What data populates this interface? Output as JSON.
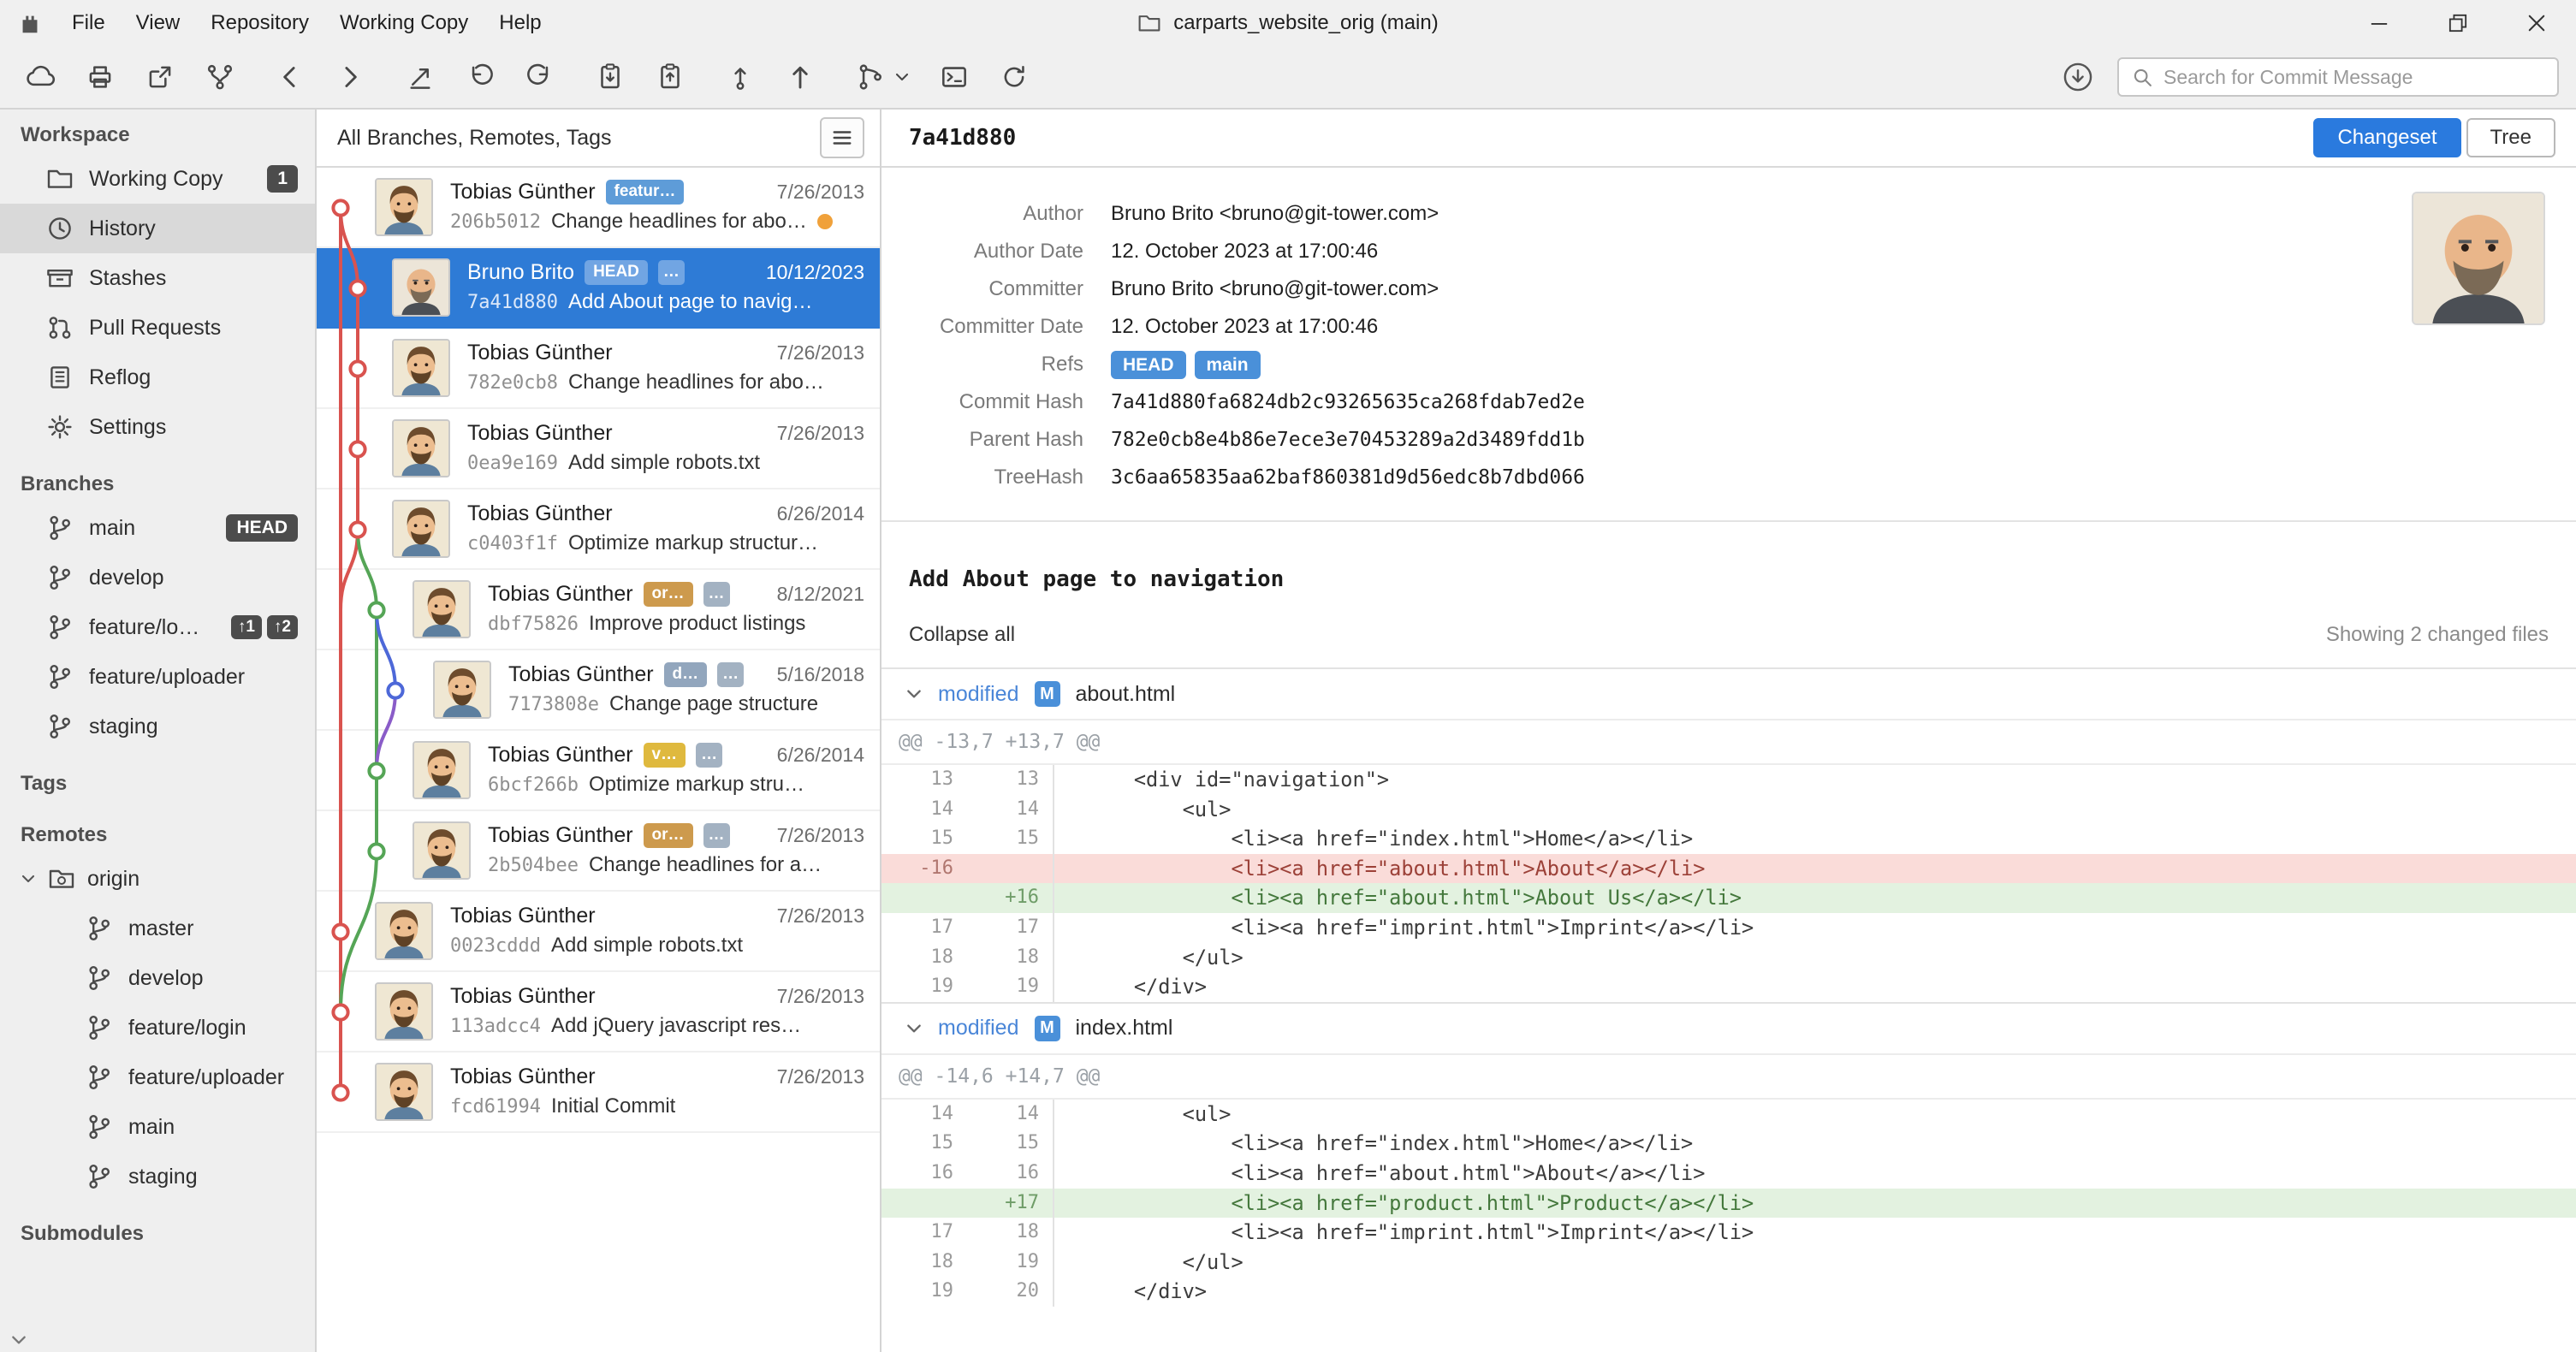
{
  "colors": {
    "selection_blue": "#2e7bd6",
    "accent_blue": "#2a7ade",
    "badge_blue": "#4a90d9",
    "badge_orange": "#cd9a4d",
    "badge_yellow": "#dfb93e",
    "badge_slate": "#92a6bd",
    "badge_dark": "#4c4c4c",
    "graph_red": "#d9534f",
    "graph_green": "#55a556",
    "graph_blue": "#4d68d8",
    "graph_purple": "#8a5cc8",
    "diff_added_bg": "#e3f2e0",
    "diff_removed_bg": "#fadcd9",
    "status_dot_orange": "#f0a13a"
  },
  "titlebar": {
    "menu": [
      "File",
      "View",
      "Repository",
      "Working Copy",
      "Help"
    ],
    "title": "carparts_website_orig (main)"
  },
  "toolbar": {
    "search_placeholder": "Search for Commit Message"
  },
  "sidebar": {
    "headers": {
      "workspace": "Workspace",
      "branches": "Branches",
      "tags": "Tags",
      "remotes": "Remotes",
      "submodules": "Submodules"
    },
    "workspace_items": [
      {
        "label": "Working Copy",
        "badge": "1"
      },
      {
        "label": "History"
      },
      {
        "label": "Stashes"
      },
      {
        "label": "Pull Requests"
      },
      {
        "label": "Reflog"
      },
      {
        "label": "Settings"
      }
    ],
    "branches": [
      {
        "label": "main",
        "badge": "HEAD"
      },
      {
        "label": "develop"
      },
      {
        "label": "feature/lo…",
        "ahead": "↑1",
        "behind": "↑2"
      },
      {
        "label": "feature/uploader"
      },
      {
        "label": "staging"
      }
    ],
    "remotes": {
      "origin": "origin",
      "children": [
        "master",
        "develop",
        "feature/login",
        "feature/uploader",
        "main",
        "staging"
      ]
    }
  },
  "commit_list": {
    "filter_label": "All Branches, Remotes, Tags",
    "commits": [
      {
        "author": "Tobias Günther",
        "badge": "featur…",
        "date": "7/26/2013",
        "hash": "206b5012",
        "message": "Change headlines for abo…"
      },
      {
        "author": "Bruno Brito",
        "badge": "HEAD",
        "badge2": "…",
        "date": "10/12/2023",
        "hash": "7a41d880",
        "message": "Add About page to navig…"
      },
      {
        "author": "Tobias Günther",
        "date": "7/26/2013",
        "hash": "782e0cb8",
        "message": "Change headlines for abo…"
      },
      {
        "author": "Tobias Günther",
        "date": "7/26/2013",
        "hash": "0ea9e169",
        "message": "Add simple robots.txt"
      },
      {
        "author": "Tobias Günther",
        "date": "6/26/2014",
        "hash": "c0403f1f",
        "message": "Optimize markup structur…"
      },
      {
        "author": "Tobias Günther",
        "badge": "or…",
        "badge2": "…",
        "date": "8/12/2021",
        "hash": "dbf75826",
        "message": "Improve product listings"
      },
      {
        "author": "Tobias Günther",
        "badge": "d…",
        "badge2": "…",
        "date": "5/16/2018",
        "hash": "7173808e",
        "message": "Change page structure"
      },
      {
        "author": "Tobias Günther",
        "badge": "v…",
        "badge2": "…",
        "date": "6/26/2014",
        "hash": "6bcf266b",
        "message": "Optimize markup stru…"
      },
      {
        "author": "Tobias Günther",
        "badge": "or…",
        "badge2": "…",
        "date": "7/26/2013",
        "hash": "2b504bee",
        "message": "Change headlines for a…"
      },
      {
        "author": "Tobias Günther",
        "date": "7/26/2013",
        "hash": "0023cddd",
        "message": "Add simple robots.txt"
      },
      {
        "author": "Tobias Günther",
        "date": "7/26/2013",
        "hash": "113adcc4",
        "message": "Add jQuery javascript res…"
      },
      {
        "author": "Tobias Günther",
        "date": "7/26/2013",
        "hash": "fcd61994",
        "message": "Initial Commit"
      }
    ]
  },
  "detail": {
    "header_hash": "7a41d880",
    "changeset_label": "Changeset",
    "tree_label": "Tree",
    "meta": {
      "author_label": "Author",
      "author": "Bruno Brito <bruno@git-tower.com>",
      "author_date_label": "Author Date",
      "author_date": "12. October 2023 at 17:00:46",
      "committer_label": "Committer",
      "committer": "Bruno Brito <bruno@git-tower.com>",
      "committer_date_label": "Committer Date",
      "committer_date": "12. October 2023 at 17:00:46",
      "refs_label": "Refs",
      "refs": [
        "HEAD",
        "main"
      ],
      "commit_hash_label": "Commit Hash",
      "commit_hash": "7a41d880fa6824db2c93265635ca268fdab7ed2e",
      "parent_hash_label": "Parent Hash",
      "parent_hash": "782e0cb8e4b86e7ece3e70453289a2d3489fdd1b",
      "tree_hash_label": "TreeHash",
      "tree_hash": "3c6aa65835aa62baf860381d9d56edc8b7dbd066"
    },
    "message": "Add About page to navigation",
    "collapse_all_label": "Collapse all",
    "changed_files_label": "Showing 2 changed files",
    "files": [
      {
        "status": "modified",
        "status_letter": "M",
        "name": "about.html",
        "hunk": "@@ -13,7 +13,7 @@",
        "lines": [
          {
            "old": "13",
            "new": "13",
            "type": "ctx",
            "code": "    <div id=\"navigation\">"
          },
          {
            "old": "14",
            "new": "14",
            "type": "ctx",
            "code": "        <ul>"
          },
          {
            "old": "15",
            "new": "15",
            "type": "ctx",
            "code": "            <li><a href=\"index.html\">Home</a></li>"
          },
          {
            "old": "-16",
            "new": "",
            "type": "rem",
            "code": "            <li><a href=\"about.html\">About</a></li>"
          },
          {
            "old": "",
            "new": "+16",
            "type": "add",
            "code": "            <li><a href=\"about.html\">About Us</a></li>"
          },
          {
            "old": "17",
            "new": "17",
            "type": "ctx",
            "code": "            <li><a href=\"imprint.html\">Imprint</a></li>"
          },
          {
            "old": "18",
            "new": "18",
            "type": "ctx",
            "code": "        </ul>"
          },
          {
            "old": "19",
            "new": "19",
            "type": "ctx",
            "code": "    </div>"
          }
        ]
      },
      {
        "status": "modified",
        "status_letter": "M",
        "name": "index.html",
        "hunk": "@@ -14,6 +14,7 @@",
        "lines": [
          {
            "old": "14",
            "new": "14",
            "type": "ctx",
            "code": "        <ul>"
          },
          {
            "old": "15",
            "new": "15",
            "type": "ctx",
            "code": "            <li><a href=\"index.html\">Home</a></li>"
          },
          {
            "old": "16",
            "new": "16",
            "type": "ctx",
            "code": "            <li><a href=\"about.html\">About</a></li>"
          },
          {
            "old": "",
            "new": "+17",
            "type": "add",
            "code": "            <li><a href=\"product.html\">Product</a></li>"
          },
          {
            "old": "17",
            "new": "18",
            "type": "ctx",
            "code": "            <li><a href=\"imprint.html\">Imprint</a></li>"
          },
          {
            "old": "18",
            "new": "19",
            "type": "ctx",
            "code": "        </ul>"
          },
          {
            "old": "19",
            "new": "20",
            "type": "ctx",
            "code": "    </div>"
          }
        ]
      }
    ]
  }
}
